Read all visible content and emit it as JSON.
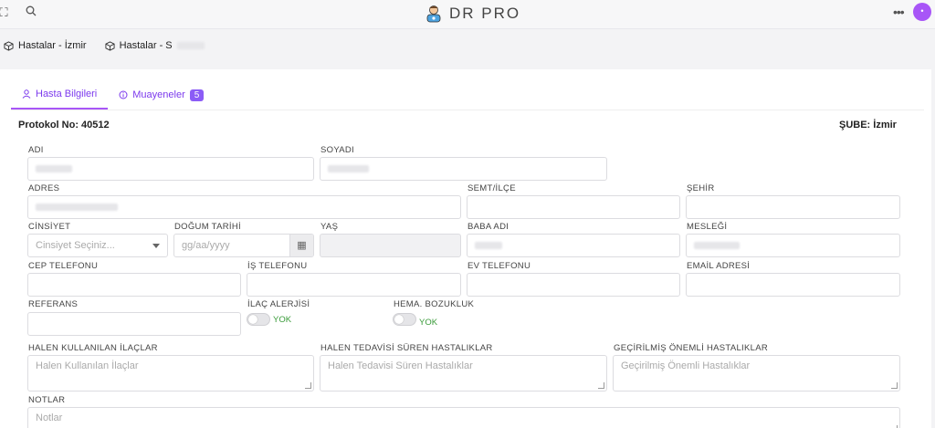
{
  "app": {
    "title": "DR PRO"
  },
  "tabs_top": [
    {
      "label": "Hastalar - İzmir"
    },
    {
      "label": "Hastalar - S"
    }
  ],
  "tabs": [
    {
      "label": "Hasta Bilgileri",
      "active": true
    },
    {
      "label": "Muayeneler",
      "badge": "5"
    }
  ],
  "protokol": {
    "label": "Protokol No: 40512"
  },
  "sube": {
    "label": "ŞUBE: İzmir"
  },
  "form": {
    "adi": {
      "label": "ADI"
    },
    "soyadi": {
      "label": "SOYADI"
    },
    "adres": {
      "label": "ADRES"
    },
    "semt": {
      "label": "SEMT/İLÇE",
      "value": ""
    },
    "sehir": {
      "label": "ŞEHİR",
      "value": ""
    },
    "cinsiyet": {
      "label": "CİNSİYET",
      "placeholder": "Cinsiyet Seçiniz..."
    },
    "dogum": {
      "label": "DOĞUM TARİHİ",
      "placeholder": "gg/aa/yyyy"
    },
    "yas": {
      "label": "YAŞ",
      "value": ""
    },
    "baba": {
      "label": "BABA ADI"
    },
    "meslek": {
      "label": "MESLEĞİ"
    },
    "cep": {
      "label": "CEP TELEFONU",
      "value": ""
    },
    "is_tel": {
      "label": "İŞ TELEFONU",
      "value": ""
    },
    "ev_tel": {
      "label": "EV TELEFONU",
      "value": ""
    },
    "email": {
      "label": "EMAİL ADRESİ",
      "value": ""
    },
    "referans": {
      "label": "REFERANS",
      "value": ""
    },
    "ilac_alerji": {
      "label": "İLAÇ ALERJİSİ",
      "state": "YOK"
    },
    "hema": {
      "label": "HEMA. BOZUKLUK",
      "state": "YOK"
    },
    "ilaclar": {
      "label": "HALEN KULLANILAN İLAÇLAR",
      "placeholder": "Halen Kullanılan İlaçlar"
    },
    "tedavi": {
      "label": "HALEN TEDAVİSİ SÜREN HASTALIKLAR",
      "placeholder": "Halen Tedavisi Süren Hastalıklar"
    },
    "gecmis": {
      "label": "GEÇİRİLMİŞ ÖNEMLİ HASTALIKLAR",
      "placeholder": "Geçirilmiş Önemli Hastalıklar"
    },
    "notlar": {
      "label": "NOTLAR",
      "placeholder": "Notlar"
    }
  },
  "colors": {
    "accent": "#a855f7",
    "success": "#3a9b3a"
  }
}
